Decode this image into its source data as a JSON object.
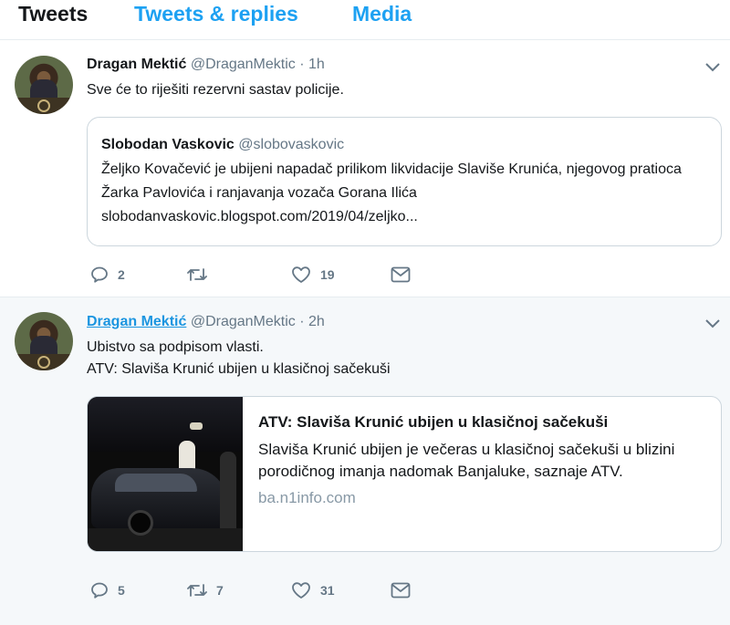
{
  "tabs": [
    "Tweets",
    "Tweets & replies",
    "Media"
  ],
  "active_tab": "Tweets",
  "tweets": [
    {
      "name": "Dragan Mektić",
      "handle": "@DraganMektic",
      "dot": "·",
      "time": "1h",
      "text": "Sve će to riješiti rezervni sastav policije.",
      "quote": {
        "name": "Slobodan Vaskovic",
        "handle": "@slobovaskovic",
        "text": "Željko Kovačević je ubijeni napadač prilikom likvidacije Slaviše Krunića, njegovog pratioca Žarka Pavlovića i ranjavanja vozača Gorana Ilića slobodanvaskovic.blogspot.com/2019/04/zeljko..."
      },
      "replies": "2",
      "retweets": "",
      "likes": "19"
    },
    {
      "name": "Dragan Mektić",
      "handle": "@DraganMektic",
      "dot": "·",
      "time": "2h",
      "text_line1": "Ubistvo sa podpisom vlasti.",
      "text_line2": "ATV: Slaviša Krunić ubijen u klasičnoj sačekuši",
      "card": {
        "title": "ATV: Slaviša Krunić ubijen u klasičnoj sačekuši",
        "description": "Slaviša Krunić ubijen je večeras u klasičnoj sačekuši u blizini porodičnog imanja nadomak Banjaluke, saznaje ATV.",
        "domain": "ba.n1info.com"
      },
      "replies": "5",
      "retweets": "7",
      "likes": "31"
    }
  ],
  "colors": {
    "accent": "#1da1f2",
    "link": "#1b95e0",
    "muted": "#657786",
    "border": "#e6ecf0",
    "hover_bg": "#f5f8fa"
  },
  "icons": [
    "reply-icon",
    "retweet-icon",
    "like-icon",
    "message-icon",
    "chevron-down-icon"
  ]
}
